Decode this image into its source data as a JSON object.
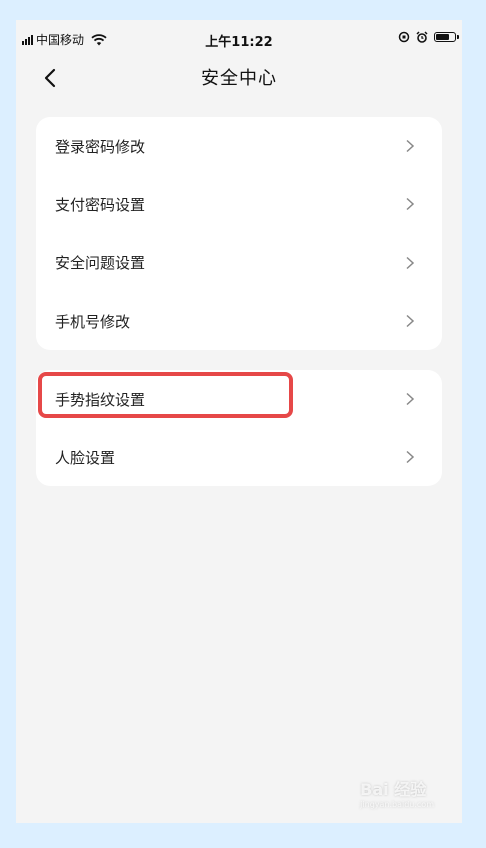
{
  "status_bar": {
    "carrier": "中国移动",
    "time": "上午11:22"
  },
  "nav": {
    "title": "安全中心"
  },
  "group1": [
    {
      "label": "登录密码修改"
    },
    {
      "label": "支付密码设置"
    },
    {
      "label": "安全问题设置"
    },
    {
      "label": "手机号修改"
    }
  ],
  "group2": [
    {
      "label": "手势指纹设置"
    },
    {
      "label": "人脸设置"
    }
  ],
  "watermark": {
    "brand": "Bai 经验",
    "url": "jingyan.baidu.com"
  },
  "colors": {
    "highlight": "#e64848",
    "background": "#f4f4f4",
    "card": "#ffffff"
  }
}
